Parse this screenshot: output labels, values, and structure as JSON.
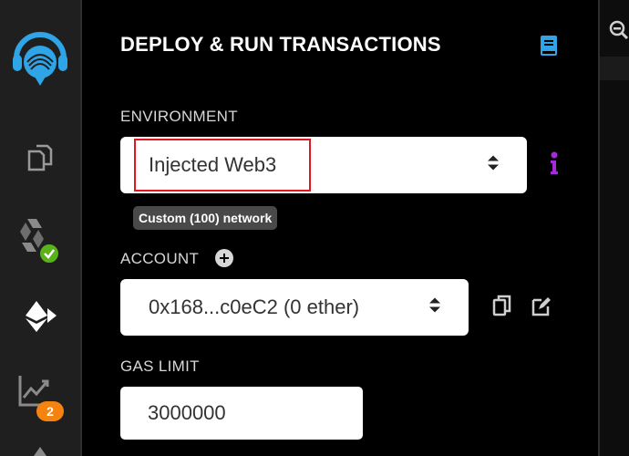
{
  "panel": {
    "title": "DEPLOY & RUN TRANSACTIONS",
    "environment": {
      "label": "ENVIRONMENT",
      "selected": "Injected Web3",
      "network_badge": "Custom (100) network"
    },
    "account": {
      "label": "ACCOUNT",
      "selected": "0x168...c0eC2 (0 ether)"
    },
    "gas_limit": {
      "label": "GAS LIMIT",
      "value": "3000000"
    }
  },
  "iconbar": {
    "analysis_badge_count": "2",
    "icons": [
      "remix-logo-icon",
      "file-explorer-icon",
      "solidity-compiler-icon",
      "deploy-run-icon",
      "analysis-icon",
      "more-icon"
    ]
  },
  "colors": {
    "sidebar_bg": "#1f1f1f",
    "panel_bg": "#000000",
    "accent_blue": "#2fa4e7",
    "info_purple": "#a52ad8",
    "success_green": "#59b21a",
    "badge_orange": "#f4830f",
    "highlight_red": "#e3141f"
  }
}
